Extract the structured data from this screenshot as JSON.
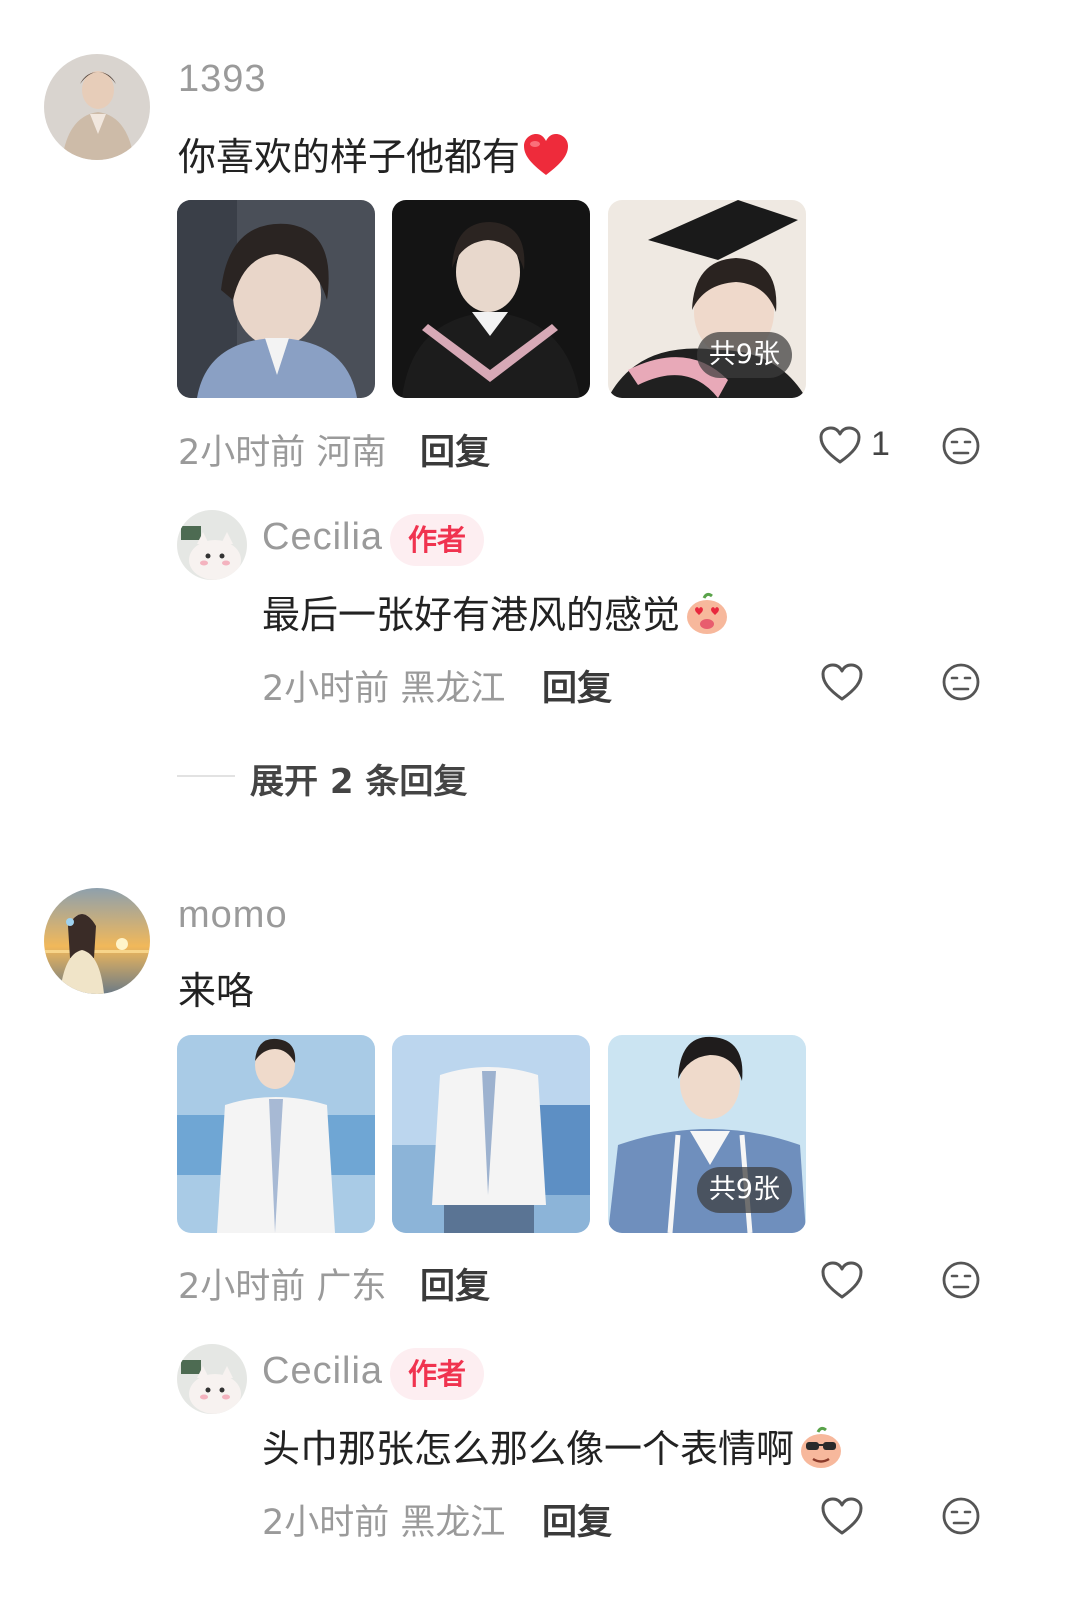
{
  "comments": [
    {
      "username": "1393",
      "avatar": "avatar-man-in-suit",
      "text": "你喜欢的样子他都有",
      "text_emoji": "red-heart",
      "images": [
        "photo-boy-denim-jacket",
        "photo-boy-graduation-gown",
        "photo-boy-mortarboard"
      ],
      "image_count_label": "共9张",
      "meta": "2小时前 河南",
      "reply_label": "回复",
      "like_count": "1",
      "reply": {
        "username": "Cecilia",
        "badge": "作者",
        "text": "最后一张好有港风的感觉",
        "text_emoji": "heart-eyes-pig",
        "meta": "2小时前 黑龙江",
        "reply_label": "回复"
      },
      "expand_label": "展开 2 条回复"
    },
    {
      "username": "momo",
      "avatar": "avatar-girl-sunset",
      "text": "来咯",
      "images": [
        "photo-white-jacket-1",
        "photo-white-jacket-2",
        "photo-denim-jacket-smile"
      ],
      "image_count_label": "共9张",
      "meta": "2小时前 广东",
      "reply_label": "回复",
      "reply": {
        "username": "Cecilia",
        "badge": "作者",
        "text": "头巾那张怎么那么像一个表情啊",
        "text_emoji": "sunglasses-pig",
        "meta": "2小时前 黑龙江",
        "reply_label": "回复"
      }
    }
  ],
  "colors": {
    "accent_red": "#f0334f",
    "badge_bg": "#fdeef1",
    "muted_text": "#9a9a9a"
  }
}
